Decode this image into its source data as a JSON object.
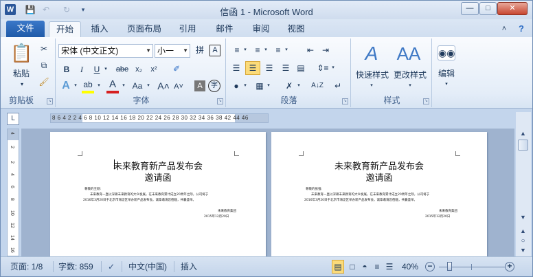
{
  "titlebar": {
    "title": "信函 1 - Microsoft Word",
    "app_icon": "W"
  },
  "tabs": [
    "文件",
    "开始",
    "插入",
    "页面布局",
    "引用",
    "邮件",
    "审阅",
    "视图"
  ],
  "ribbon": {
    "clipboard": {
      "label": "剪贴板",
      "paste": "粘贴"
    },
    "font": {
      "label": "字体",
      "font_name": "宋体 (中文正文)",
      "font_size": "小一",
      "font_color": "#d62020",
      "highlight_color": "#ffff00"
    },
    "paragraph": {
      "label": "段落"
    },
    "styles": {
      "label": "样式",
      "quick": "快速样式",
      "change": "更改样式"
    },
    "editing": {
      "label": "编辑"
    }
  },
  "ruler": "8 6 4 2  2 4 6 8 10 12 14 16 18 20 22 24 26 28 30 32 34 36 38  42 44 46",
  "vruler": [
    "4",
    "2",
    "2",
    "4",
    "6",
    "8",
    "10",
    "12",
    "14",
    "16"
  ],
  "pages": [
    {
      "title": "未来教育新产品发布会",
      "subtitle": "邀请函",
      "greeting": "尊敬的王刚:",
      "body1": "未来教育一直以深耕未来教育的大众发展，在未来教育累计成立20周年之际，公司将于",
      "body2": "2016年3月20日于北京市海淀区举办新产品发布会。诚挚邀请您莅临，共襄盛举。",
      "sign": "未来教育集团",
      "date": "2015年12月20日"
    },
    {
      "title": "未来教育新产品发布会",
      "subtitle": "邀请函",
      "greeting": "尊敬的张强:",
      "body1": "未来教育一直以深耕未来教育的大众发展，在未来教育累计成立20周年之际，公司将于",
      "body2": "2016年3月20日于北京市海淀区举办新产品发布会。诚挚邀请您莅临，共襄盛举。",
      "sign": "未来教育集团",
      "date": "2015年12月20日"
    }
  ],
  "status": {
    "page": "页面: 1/8",
    "words": "字数: 859",
    "language": "中文(中国)",
    "mode": "插入",
    "zoom": "40%",
    "zoom_fraction": 0.4
  }
}
